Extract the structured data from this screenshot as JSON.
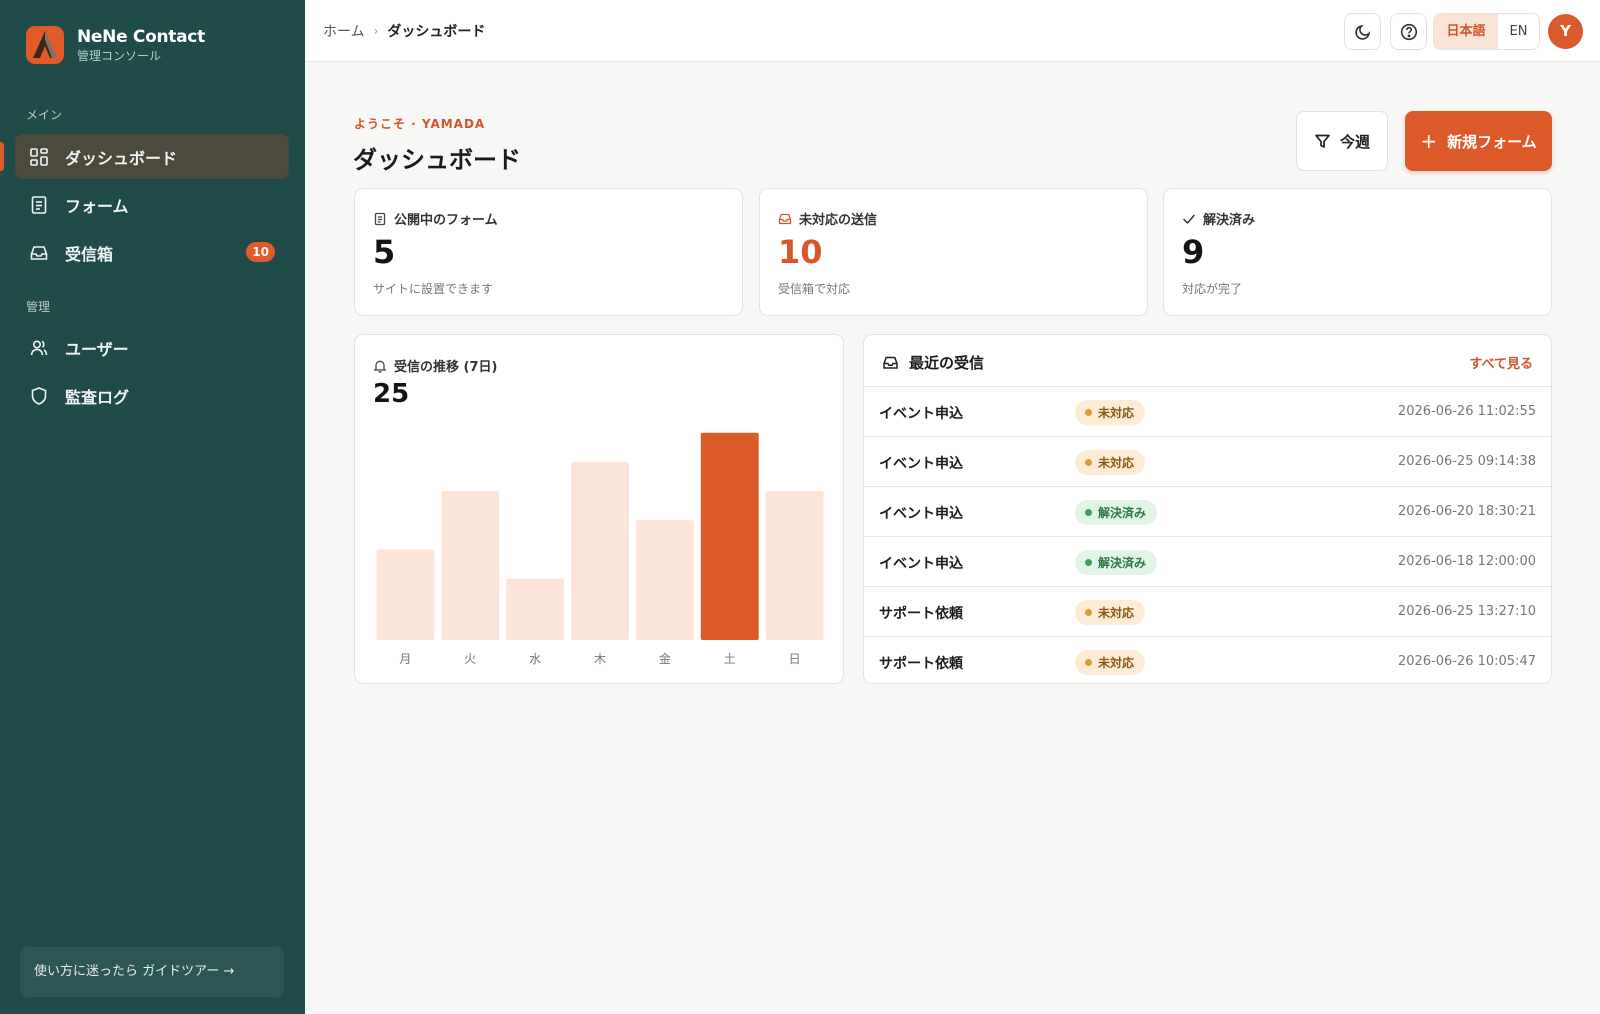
{
  "app": {
    "name": "NeNe Contact",
    "subtitle": "管理コンソール"
  },
  "sidebar": {
    "sections": [
      {
        "label": "メイン"
      },
      {
        "label": "管理"
      }
    ],
    "items": [
      {
        "label": "ダッシュボード",
        "icon": "dashboard-icon",
        "active": true
      },
      {
        "label": "フォーム",
        "icon": "form-icon"
      },
      {
        "label": "受信箱",
        "icon": "inbox-icon",
        "badge": "10"
      },
      {
        "label": "ユーザー",
        "icon": "users-icon"
      },
      {
        "label": "監査ログ",
        "icon": "shield-icon"
      }
    ],
    "guide": "使い方に迷ったら ガイドツアー →"
  },
  "topbar": {
    "breadcrumb": [
      "ホーム",
      "ダッシュボード"
    ],
    "breadcrumb_sep": "›",
    "lang_ja": "日本語",
    "lang_en": "EN",
    "avatar": "Y"
  },
  "header": {
    "welcome": "ようこそ · YAMADA",
    "title": "ダッシュボード",
    "filter_label": "今週",
    "new_label": "新規フォーム"
  },
  "stats": [
    {
      "label": "公開中のフォーム",
      "value": "5",
      "sub": "サイトに設置できます",
      "icon": "document-icon"
    },
    {
      "label": "未対応の送信",
      "value": "10",
      "sub": "受信箱で対応",
      "icon": "inbox-icon"
    },
    {
      "label": "解決済み",
      "value": "9",
      "sub": "対応が完了",
      "icon": "check-icon"
    }
  ],
  "chart": {
    "label": "受信の推移 (7日)",
    "total": "25"
  },
  "chart_data": {
    "type": "bar",
    "categories": [
      "月",
      "火",
      "水",
      "木",
      "金",
      "土",
      "日"
    ],
    "values": [
      3.1,
      5.1,
      2.1,
      6.1,
      4.1,
      7.1,
      5.1
    ],
    "ylim": [
      0,
      7.5
    ],
    "grid": false,
    "highlight_index": 5,
    "colors": {
      "bar": "#fce4d9",
      "highlight": "#da5a28"
    }
  },
  "recent": {
    "title": "最近の受信",
    "view_all": "すべて見る",
    "rows": [
      {
        "name": "イベント申込",
        "status": "未対応",
        "state": "pending",
        "time": "2026-06-26 11:02:55"
      },
      {
        "name": "イベント申込",
        "status": "未対応",
        "state": "pending",
        "time": "2026-06-25 09:14:38"
      },
      {
        "name": "イベント申込",
        "status": "解決済み",
        "state": "resolved",
        "time": "2026-06-20 18:30:21"
      },
      {
        "name": "イベント申込",
        "status": "解決済み",
        "state": "resolved",
        "time": "2026-06-18 12:00:00"
      },
      {
        "name": "サポート依頼",
        "status": "未対応",
        "state": "pending",
        "time": "2026-06-25 13:27:10"
      },
      {
        "name": "サポート依頼",
        "status": "未対応",
        "state": "pending",
        "time": "2026-06-26 10:05:47"
      }
    ]
  }
}
